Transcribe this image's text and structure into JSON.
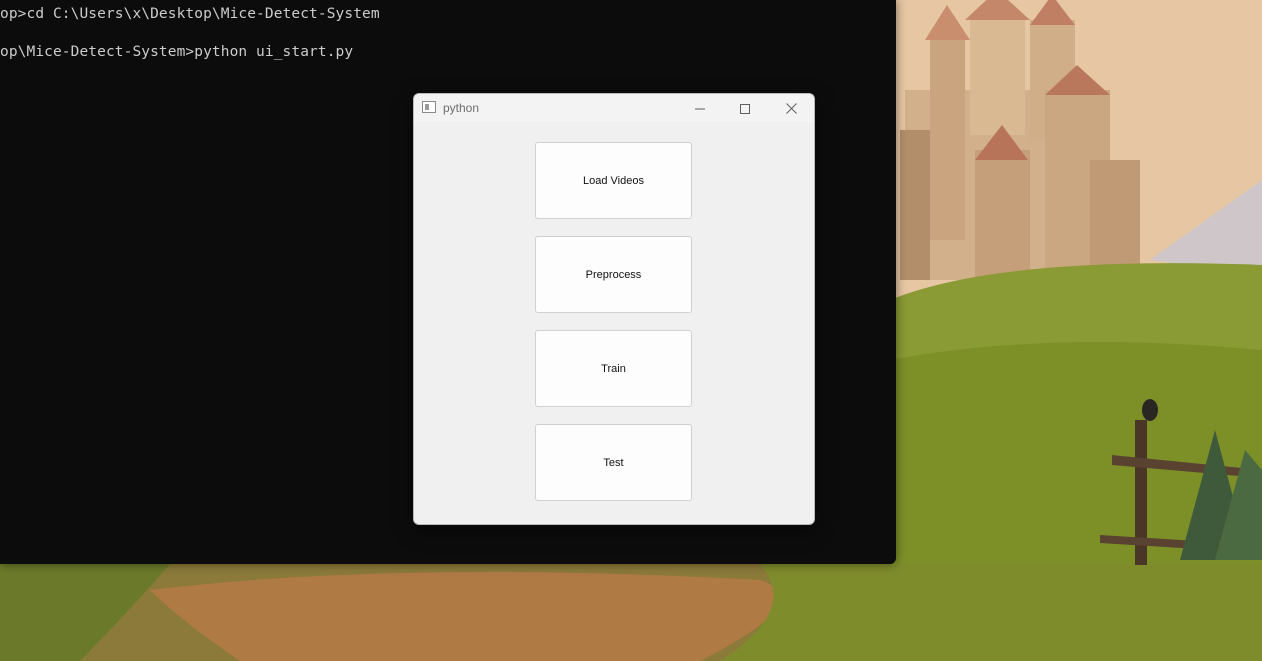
{
  "terminal": {
    "lines": [
      "op>cd C:\\Users\\x\\Desktop\\Mice-Detect-System",
      "op\\Mice-Detect-System>python ui_start.py"
    ]
  },
  "window": {
    "title": "python",
    "icon": "app-window-icon",
    "controls": {
      "minimize": "minimize-icon",
      "maximize": "maximize-icon",
      "close": "close-icon"
    },
    "buttons": [
      {
        "label": "Load Videos"
      },
      {
        "label": "Preprocess"
      },
      {
        "label": "Train"
      },
      {
        "label": "Test"
      }
    ]
  },
  "colors": {
    "terminal_bg": "#0c0c0c",
    "terminal_text": "#cccccc",
    "window_bg": "#f0f0f0",
    "button_bg": "#fdfdfd"
  }
}
